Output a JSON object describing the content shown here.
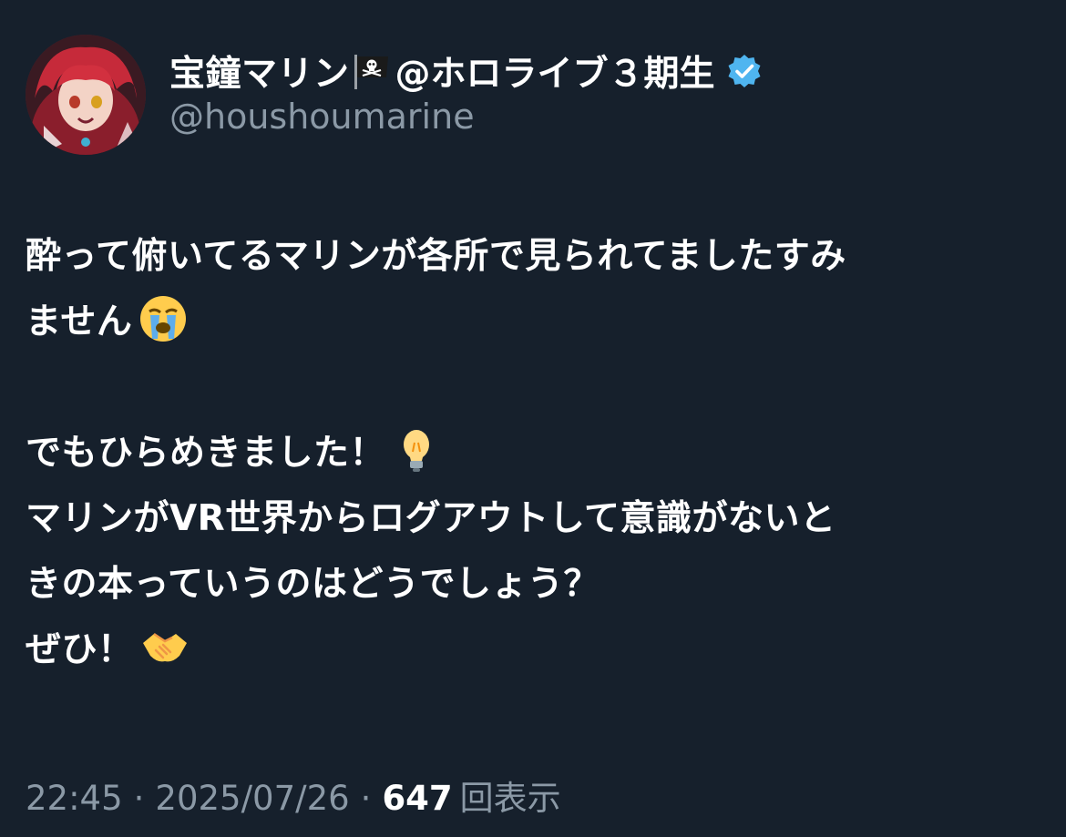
{
  "user": {
    "display_name": "宝鐘マリン",
    "affiliation": "@ホロライブ３期生",
    "handle": "@houshoumarine",
    "flag_icon": "pirate-flag-icon",
    "verified_icon": "verified-badge-icon",
    "verified_color": "#4fb5f0"
  },
  "tweet": {
    "line1": "酔って俯いてるマリンが各所で見られてましたすみ",
    "line2": "ません",
    "line3": "でもひらめきました！",
    "line4": "マリンがVR世界からログアウトして意識がないと",
    "line5": "きの本っていうのはどうでしょう？",
    "line6": "ぜひ！",
    "emojis": [
      "loudly-crying-face-emoji",
      "light-bulb-emoji",
      "handshake-emoji"
    ]
  },
  "meta": {
    "time": "22:45",
    "separator": "·",
    "date": "2025/07/26",
    "views_count": "647",
    "views_label": "回表示"
  },
  "colors": {
    "background": "#16202c",
    "text_primary": "#ffffff",
    "text_secondary": "#8b99a6"
  }
}
